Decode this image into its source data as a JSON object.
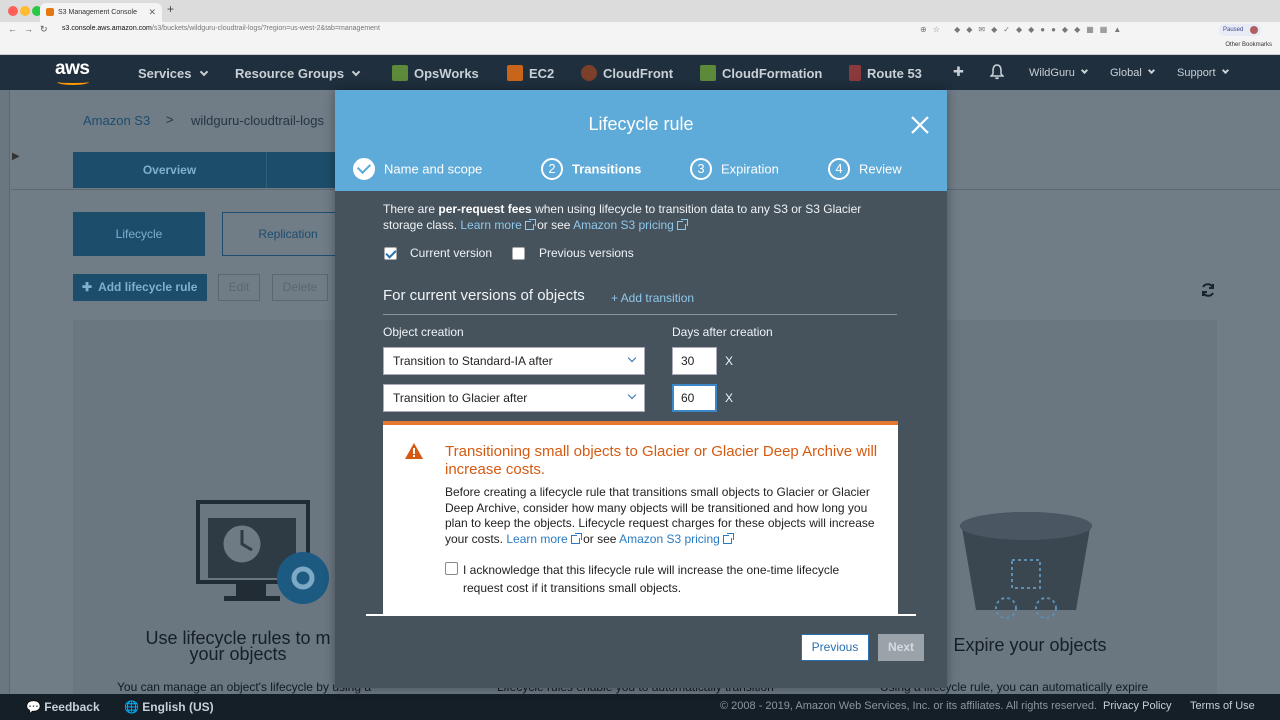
{
  "browser": {
    "tab_title": "S3 Management Console",
    "url_host": "s3.console.aws.amazon.com",
    "url_path": "/s3/buckets/wildguru-cloudtrail-logs/?region=us-west-2&tab=management",
    "paused_label": "Paused",
    "bookmarks_label": "Other Bookmarks"
  },
  "awsnav": {
    "logo": "aws",
    "services": "Services",
    "resource_groups": "Resource Groups",
    "shortcuts": [
      "OpsWorks",
      "EC2",
      "CloudFront",
      "CloudFormation",
      "Route 53"
    ],
    "account": "WildGuru",
    "region": "Global",
    "support": "Support"
  },
  "page": {
    "breadcrumb_root": "Amazon S3",
    "breadcrumb_sep": ">",
    "bucket": "wildguru-cloudtrail-logs",
    "tab_overview": "Overview",
    "btn_lifecycle": "Lifecycle",
    "btn_replication": "Replication",
    "btn_add_rule": "Add lifecycle rule",
    "btn_edit": "Edit",
    "btn_delete": "Delete",
    "left_title": "Use lifecycle rules to m\nyour objects",
    "right_title": "Expire your objects",
    "sub_left": "You can manage an object's lifecycle by using a",
    "sub_mid": "Lifecycle rules enable you to automatically transition",
    "sub_right": "Using a lifecycle rule, you can automatically expire"
  },
  "modal": {
    "title": "Lifecycle rule",
    "steps": [
      {
        "num": "✓",
        "label": "Name and scope"
      },
      {
        "num": "2",
        "label": "Transitions"
      },
      {
        "num": "3",
        "label": "Expiration"
      },
      {
        "num": "4",
        "label": "Review"
      }
    ],
    "fee_pre": "There are ",
    "fee_bold": "per-request fees",
    "fee_post": " when using lifecycle to transition data to any S3 or S3 Glacier storage class. ",
    "learn_more": "Learn more",
    "or_see": " or see ",
    "pricing": "Amazon S3 pricing",
    "current_version": "Current version",
    "previous_versions": "Previous versions",
    "section_title": "For current versions of objects",
    "add_transition": "+ Add transition",
    "col_object_creation": "Object creation",
    "col_days": "Days after creation",
    "rows": [
      {
        "transition": "Transition to Standard-IA after",
        "days": "30",
        "remove": "X"
      },
      {
        "transition": "Transition to Glacier after",
        "days": "60",
        "remove": "X"
      }
    ],
    "warning_title": "Transitioning small objects to Glacier or Glacier Deep Archive will increase costs.",
    "warning_text": "Before creating a lifecycle rule that transitions small objects to Glacier or Glacier Deep Archive, consider how many objects will be transitioned and how long you plan to keep the objects. Lifecycle request charges for these objects will increase your costs. ",
    "ack_text": "I acknowledge that this lifecycle rule will increase the one-time lifecycle request cost if it transitions small objects.",
    "btn_previous": "Previous",
    "btn_next": "Next"
  },
  "footer": {
    "feedback": "Feedback",
    "language": "English (US)",
    "copyright": "© 2008 - 2019, Amazon Web Services, Inc. or its affiliates. All rights reserved.",
    "privacy": "Privacy Policy",
    "terms": "Terms of Use"
  },
  "colors": {
    "modal_header": "#5eaad8",
    "aws_nav": "#1f2f3d",
    "warning_accent": "#e5772e"
  }
}
